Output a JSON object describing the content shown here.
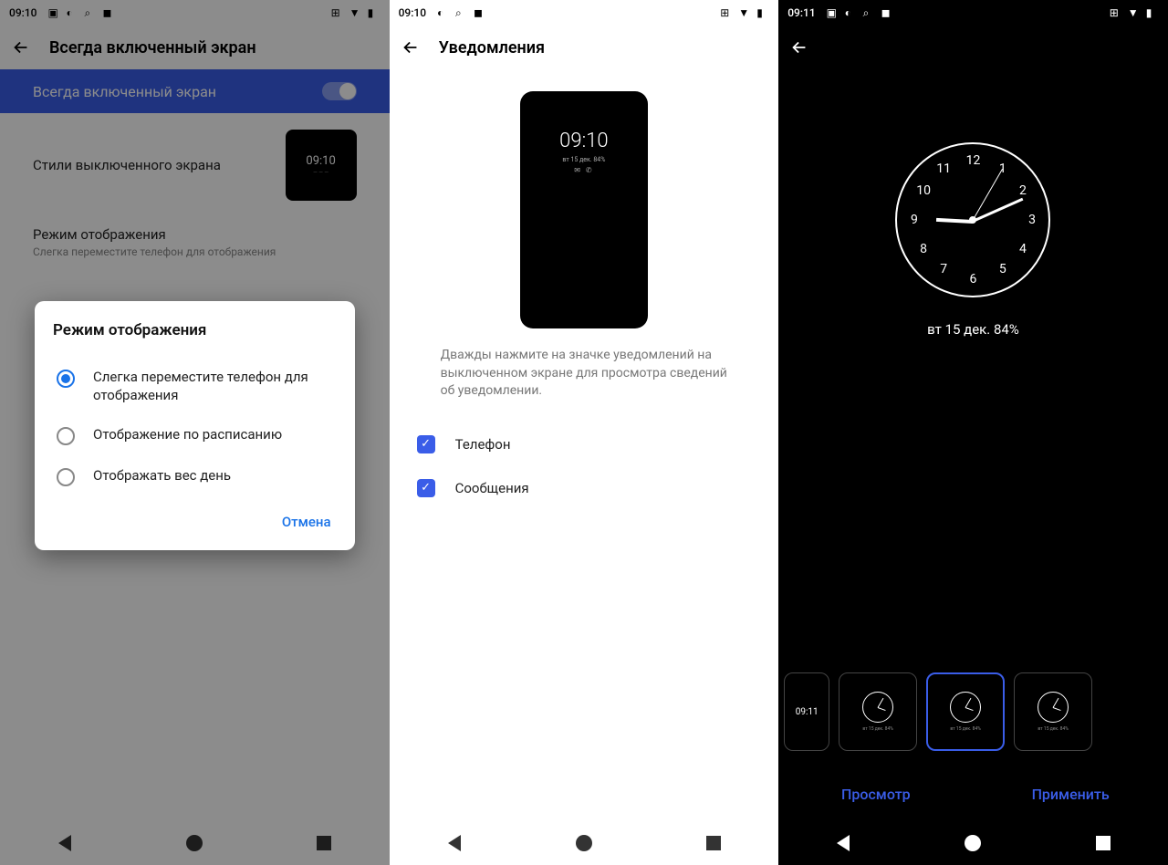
{
  "panel1": {
    "status": {
      "time": "09:10"
    },
    "title": "Всегда включенный экран",
    "toggle_label": "Всегда включенный экран",
    "styles_label": "Стили выключенного экрана",
    "thumb_time": "09:10",
    "mode_title": "Режим отображения",
    "mode_sub": "Слегка переместите телефон для отображения",
    "dialog": {
      "title": "Режим отображения",
      "opt1": "Слегка переместите телефон для отображения",
      "opt2": "Отображение по расписанию",
      "opt3": "Отображать вес день",
      "cancel": "Отмена"
    }
  },
  "panel2": {
    "status": {
      "time": "09:10"
    },
    "title": "Уведомления",
    "mock": {
      "time": "09:10",
      "sub": "вт 15 дек. 84%"
    },
    "hint": "Дважды нажмите на значке уведомлений на выключенном экране для просмотра сведений об уведомлении.",
    "chk1": "Телефон",
    "chk2": "Сообщения"
  },
  "panel3": {
    "status": {
      "time": "09:11"
    },
    "date": "вт 15 дек. 84%",
    "thumb_time": "09:11",
    "thumb_sub": "вт 15 дек. 84%",
    "preview": "Просмотр",
    "apply": "Применить"
  }
}
